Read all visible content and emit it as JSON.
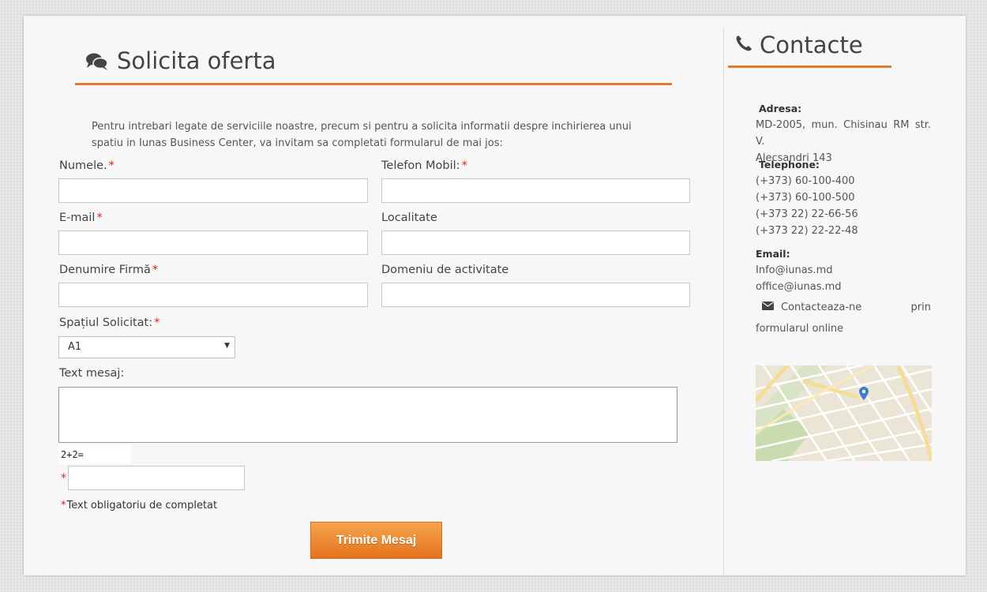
{
  "form": {
    "title": "Solicita oferta",
    "intro": "Pentru intrebari legate de serviciile noastre, precum si pentru a solicita informatii despre inchirierea unui spatiu in Iunas Business Center, va invitam sa completati formularul de mai jos:",
    "fields": {
      "name_label": "Numele.",
      "phone_label": "Telefon Mobil:",
      "email_label": "E-mail",
      "locality_label": "Localitate",
      "company_label": "Denumire Firmă",
      "domain_label": "Domeniu de activitate",
      "space_label": "Spațiul Solicitat:",
      "space_value": "A1",
      "message_label": "Text mesaj:"
    },
    "required_mark": "*",
    "captcha_question": "2+2=",
    "mandatory_note": "Text obligatoriu de completat",
    "submit_label": "Trimite Mesaj"
  },
  "contact": {
    "title": "Contacte",
    "address_heading": "Adresa:",
    "address_line1": "MD-2005, mun. Chisinau RM str. V.",
    "address_line2": "Alecsandri 143",
    "phone_heading": "Telephone:",
    "phones": [
      "(+373) 60-100-400",
      "(+373) 60-100-500",
      "(+373 22) 22-66-56",
      "(+373 22) 22-22-48"
    ],
    "email_heading": "Email:",
    "emails": [
      "Info@iunas.md",
      "office@iunas.md"
    ],
    "form_link_part1": "Contacteaza-ne",
    "form_link_part2": "prin",
    "form_link_part3": "formularul online"
  },
  "colors": {
    "accent": "#e07b2d",
    "required": "#e02020",
    "button": "#ee8a2f"
  },
  "icons": {
    "form_title_icon": "comments-icon",
    "contact_title_icon": "phone-icon",
    "contact_link_icon": "envelope-icon",
    "map_marker_icon": "map-marker-icon"
  }
}
